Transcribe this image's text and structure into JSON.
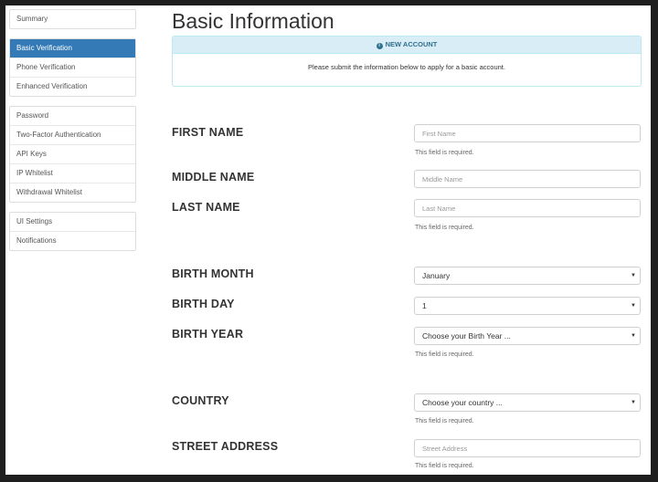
{
  "sidebar": {
    "groups": [
      [
        "Summary"
      ],
      [
        "Basic Verification",
        "Phone Verification",
        "Enhanced Verification"
      ],
      [
        "Password",
        "Two-Factor Authentication",
        "API Keys",
        "IP Whitelist",
        "Withdrawal Whitelist"
      ],
      [
        "UI Settings",
        "Notifications"
      ]
    ],
    "active": "Basic Verification"
  },
  "page": {
    "title": "Basic Information"
  },
  "alert": {
    "heading": "NEW ACCOUNT",
    "icon": "info-circle-icon",
    "message": "Please submit the information below to apply for a basic account."
  },
  "form": {
    "required_text": "This field is required.",
    "first_name": {
      "label": "FIRST NAME",
      "placeholder": "First Name"
    },
    "middle_name": {
      "label": "MIDDLE NAME",
      "placeholder": "Middle Name"
    },
    "last_name": {
      "label": "LAST NAME",
      "placeholder": "Last Name"
    },
    "birth_month": {
      "label": "BIRTH MONTH",
      "value": "January"
    },
    "birth_day": {
      "label": "BIRTH DAY",
      "value": "1"
    },
    "birth_year": {
      "label": "BIRTH YEAR",
      "value": "Choose your Birth Year ..."
    },
    "country": {
      "label": "COUNTRY",
      "value": "Choose your country ..."
    },
    "street_address": {
      "label": "STREET ADDRESS",
      "placeholder": "Street Address"
    }
  },
  "colors": {
    "active_nav": "#337ab7",
    "alert_bg": "#d9edf7",
    "alert_text": "#31708f"
  }
}
